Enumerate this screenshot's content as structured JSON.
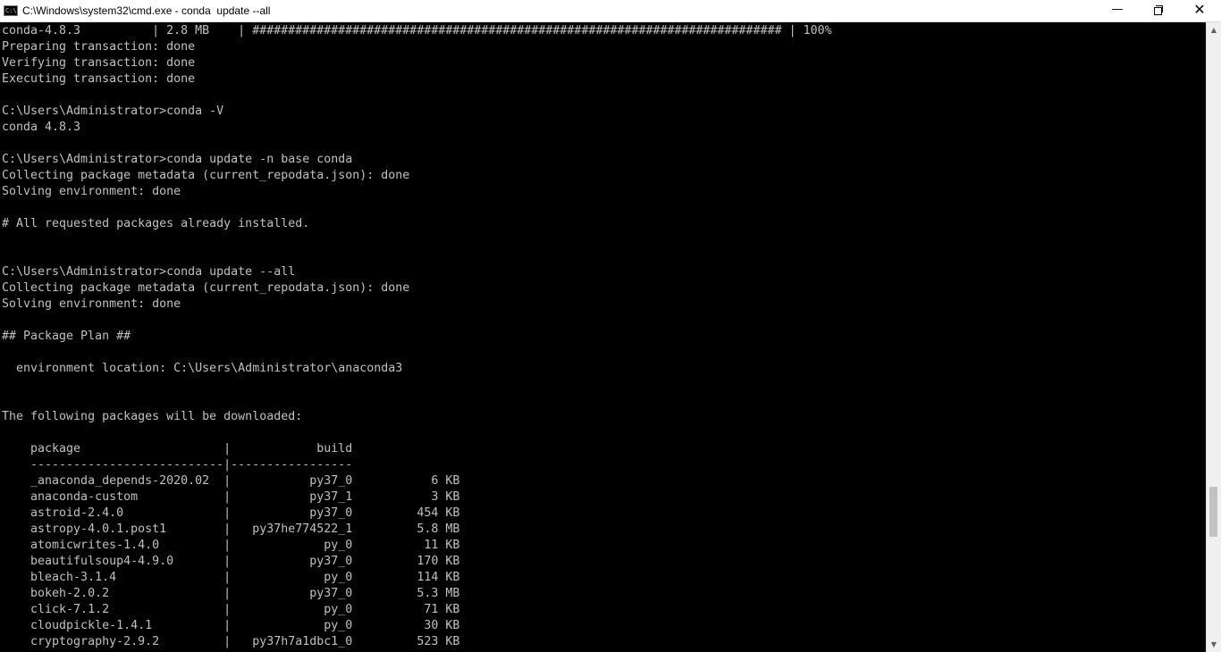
{
  "window": {
    "title": "C:\\Windows\\system32\\cmd.exe - conda  update --all",
    "icon_label": "C:\\",
    "controls": {
      "minimize": "—",
      "close": "✕"
    }
  },
  "console": {
    "lines": [
      "conda-4.8.3          | 2.8 MB    | ########################################################################## | 100%",
      "Preparing transaction: done",
      "Verifying transaction: done",
      "Executing transaction: done",
      "",
      "C:\\Users\\Administrator>conda -V",
      "conda 4.8.3",
      "",
      "C:\\Users\\Administrator>conda update -n base conda",
      "Collecting package metadata (current_repodata.json): done",
      "Solving environment: done",
      "",
      "# All requested packages already installed.",
      "",
      "",
      "C:\\Users\\Administrator>conda update --all",
      "Collecting package metadata (current_repodata.json): done",
      "Solving environment: done",
      "",
      "## Package Plan ##",
      "",
      "  environment location: C:\\Users\\Administrator\\anaconda3",
      "",
      "",
      "The following packages will be downloaded:",
      "",
      "    package                    |            build",
      "    ---------------------------|-----------------",
      "    _anaconda_depends-2020.02  |           py37_0           6 KB",
      "    anaconda-custom            |           py37_1           3 KB",
      "    astroid-2.4.0              |           py37_0         454 KB",
      "    astropy-4.0.1.post1        |   py37he774522_1         5.8 MB",
      "    atomicwrites-1.4.0         |             py_0          11 KB",
      "    beautifulsoup4-4.9.0       |           py37_0         170 KB",
      "    bleach-3.1.4               |             py_0         114 KB",
      "    bokeh-2.0.2                |           py37_0         5.3 MB",
      "    click-7.1.2                |             py_0          71 KB",
      "    cloudpickle-1.4.1          |             py_0          30 KB",
      "    cryptography-2.9.2         |   py37h7a1dbc1_0         523 KB"
    ]
  },
  "scrollbar": {
    "up_arrow": "▲",
    "down_arrow": "▼"
  }
}
